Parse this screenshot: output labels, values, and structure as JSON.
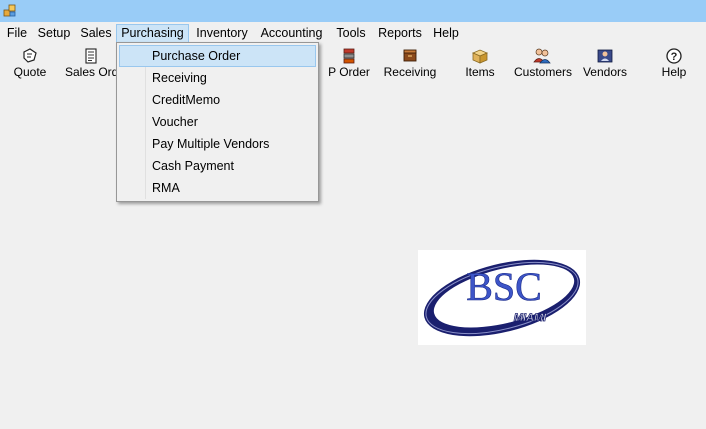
{
  "app": {
    "icon": "app-window-icon"
  },
  "menu": {
    "items": [
      {
        "label": "File"
      },
      {
        "label": "Setup"
      },
      {
        "label": "Sales"
      },
      {
        "label": "Purchasing",
        "active": true
      },
      {
        "label": "Inventory"
      },
      {
        "label": "Accounting"
      },
      {
        "label": "Tools"
      },
      {
        "label": "Reports"
      },
      {
        "label": "Help"
      }
    ]
  },
  "toolbar": {
    "buttons": [
      {
        "label": "Quote",
        "icon": "quote-icon"
      },
      {
        "label": "Sales Orde",
        "icon": "sales-order-icon"
      },
      {
        "label": "P Order",
        "icon": "purchase-order-icon"
      },
      {
        "label": "Receiving",
        "icon": "receiving-icon"
      },
      {
        "label": "Items",
        "icon": "items-box-icon"
      },
      {
        "label": "Customers",
        "icon": "customers-icon"
      },
      {
        "label": "Vendors",
        "icon": "vendors-icon"
      },
      {
        "label": "Help",
        "icon": "help-question-icon"
      }
    ]
  },
  "purchasing_menu": {
    "items": [
      {
        "label": "Purchase Order",
        "highlighted": true
      },
      {
        "label": "Receiving"
      },
      {
        "label": "CreditMemo"
      },
      {
        "label": "Voucher"
      },
      {
        "label": "Pay Multiple Vendors"
      },
      {
        "label": "Cash Payment"
      },
      {
        "label": "RMA"
      }
    ]
  },
  "logo": {
    "text": "BSC",
    "subtext": "MIAMI",
    "colors": {
      "ring": "#1a1f6e",
      "letters": "#3d55c8",
      "accent": "#ffffff"
    }
  },
  "colors": {
    "titlebar": "#99ccf7",
    "menu_highlight": "#cce4f7",
    "menu_highlight_border": "#99c7ee"
  }
}
